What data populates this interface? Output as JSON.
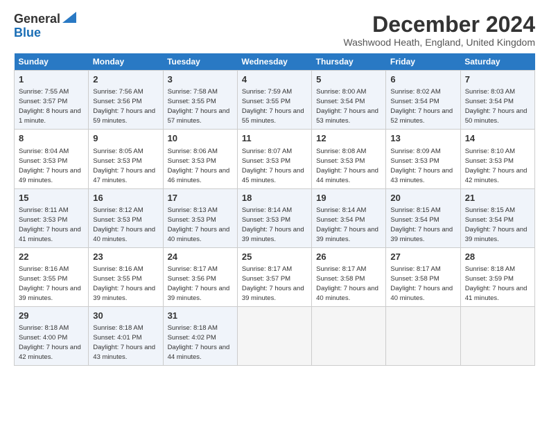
{
  "logo": {
    "line1": "General",
    "line2": "Blue"
  },
  "title": "December 2024",
  "subtitle": "Washwood Heath, England, United Kingdom",
  "days_header": [
    "Sunday",
    "Monday",
    "Tuesday",
    "Wednesday",
    "Thursday",
    "Friday",
    "Saturday"
  ],
  "weeks": [
    [
      {
        "day": "1",
        "sunrise": "Sunrise: 7:55 AM",
        "sunset": "Sunset: 3:57 PM",
        "daylight": "Daylight: 8 hours and 1 minute."
      },
      {
        "day": "2",
        "sunrise": "Sunrise: 7:56 AM",
        "sunset": "Sunset: 3:56 PM",
        "daylight": "Daylight: 7 hours and 59 minutes."
      },
      {
        "day": "3",
        "sunrise": "Sunrise: 7:58 AM",
        "sunset": "Sunset: 3:55 PM",
        "daylight": "Daylight: 7 hours and 57 minutes."
      },
      {
        "day": "4",
        "sunrise": "Sunrise: 7:59 AM",
        "sunset": "Sunset: 3:55 PM",
        "daylight": "Daylight: 7 hours and 55 minutes."
      },
      {
        "day": "5",
        "sunrise": "Sunrise: 8:00 AM",
        "sunset": "Sunset: 3:54 PM",
        "daylight": "Daylight: 7 hours and 53 minutes."
      },
      {
        "day": "6",
        "sunrise": "Sunrise: 8:02 AM",
        "sunset": "Sunset: 3:54 PM",
        "daylight": "Daylight: 7 hours and 52 minutes."
      },
      {
        "day": "7",
        "sunrise": "Sunrise: 8:03 AM",
        "sunset": "Sunset: 3:54 PM",
        "daylight": "Daylight: 7 hours and 50 minutes."
      }
    ],
    [
      {
        "day": "8",
        "sunrise": "Sunrise: 8:04 AM",
        "sunset": "Sunset: 3:53 PM",
        "daylight": "Daylight: 7 hours and 49 minutes."
      },
      {
        "day": "9",
        "sunrise": "Sunrise: 8:05 AM",
        "sunset": "Sunset: 3:53 PM",
        "daylight": "Daylight: 7 hours and 47 minutes."
      },
      {
        "day": "10",
        "sunrise": "Sunrise: 8:06 AM",
        "sunset": "Sunset: 3:53 PM",
        "daylight": "Daylight: 7 hours and 46 minutes."
      },
      {
        "day": "11",
        "sunrise": "Sunrise: 8:07 AM",
        "sunset": "Sunset: 3:53 PM",
        "daylight": "Daylight: 7 hours and 45 minutes."
      },
      {
        "day": "12",
        "sunrise": "Sunrise: 8:08 AM",
        "sunset": "Sunset: 3:53 PM",
        "daylight": "Daylight: 7 hours and 44 minutes."
      },
      {
        "day": "13",
        "sunrise": "Sunrise: 8:09 AM",
        "sunset": "Sunset: 3:53 PM",
        "daylight": "Daylight: 7 hours and 43 minutes."
      },
      {
        "day": "14",
        "sunrise": "Sunrise: 8:10 AM",
        "sunset": "Sunset: 3:53 PM",
        "daylight": "Daylight: 7 hours and 42 minutes."
      }
    ],
    [
      {
        "day": "15",
        "sunrise": "Sunrise: 8:11 AM",
        "sunset": "Sunset: 3:53 PM",
        "daylight": "Daylight: 7 hours and 41 minutes."
      },
      {
        "day": "16",
        "sunrise": "Sunrise: 8:12 AM",
        "sunset": "Sunset: 3:53 PM",
        "daylight": "Daylight: 7 hours and 40 minutes."
      },
      {
        "day": "17",
        "sunrise": "Sunrise: 8:13 AM",
        "sunset": "Sunset: 3:53 PM",
        "daylight": "Daylight: 7 hours and 40 minutes."
      },
      {
        "day": "18",
        "sunrise": "Sunrise: 8:14 AM",
        "sunset": "Sunset: 3:53 PM",
        "daylight": "Daylight: 7 hours and 39 minutes."
      },
      {
        "day": "19",
        "sunrise": "Sunrise: 8:14 AM",
        "sunset": "Sunset: 3:54 PM",
        "daylight": "Daylight: 7 hours and 39 minutes."
      },
      {
        "day": "20",
        "sunrise": "Sunrise: 8:15 AM",
        "sunset": "Sunset: 3:54 PM",
        "daylight": "Daylight: 7 hours and 39 minutes."
      },
      {
        "day": "21",
        "sunrise": "Sunrise: 8:15 AM",
        "sunset": "Sunset: 3:54 PM",
        "daylight": "Daylight: 7 hours and 39 minutes."
      }
    ],
    [
      {
        "day": "22",
        "sunrise": "Sunrise: 8:16 AM",
        "sunset": "Sunset: 3:55 PM",
        "daylight": "Daylight: 7 hours and 39 minutes."
      },
      {
        "day": "23",
        "sunrise": "Sunrise: 8:16 AM",
        "sunset": "Sunset: 3:55 PM",
        "daylight": "Daylight: 7 hours and 39 minutes."
      },
      {
        "day": "24",
        "sunrise": "Sunrise: 8:17 AM",
        "sunset": "Sunset: 3:56 PM",
        "daylight": "Daylight: 7 hours and 39 minutes."
      },
      {
        "day": "25",
        "sunrise": "Sunrise: 8:17 AM",
        "sunset": "Sunset: 3:57 PM",
        "daylight": "Daylight: 7 hours and 39 minutes."
      },
      {
        "day": "26",
        "sunrise": "Sunrise: 8:17 AM",
        "sunset": "Sunset: 3:58 PM",
        "daylight": "Daylight: 7 hours and 40 minutes."
      },
      {
        "day": "27",
        "sunrise": "Sunrise: 8:17 AM",
        "sunset": "Sunset: 3:58 PM",
        "daylight": "Daylight: 7 hours and 40 minutes."
      },
      {
        "day": "28",
        "sunrise": "Sunrise: 8:18 AM",
        "sunset": "Sunset: 3:59 PM",
        "daylight": "Daylight: 7 hours and 41 minutes."
      }
    ],
    [
      {
        "day": "29",
        "sunrise": "Sunrise: 8:18 AM",
        "sunset": "Sunset: 4:00 PM",
        "daylight": "Daylight: 7 hours and 42 minutes."
      },
      {
        "day": "30",
        "sunrise": "Sunrise: 8:18 AM",
        "sunset": "Sunset: 4:01 PM",
        "daylight": "Daylight: 7 hours and 43 minutes."
      },
      {
        "day": "31",
        "sunrise": "Sunrise: 8:18 AM",
        "sunset": "Sunset: 4:02 PM",
        "daylight": "Daylight: 7 hours and 44 minutes."
      },
      null,
      null,
      null,
      null
    ]
  ]
}
